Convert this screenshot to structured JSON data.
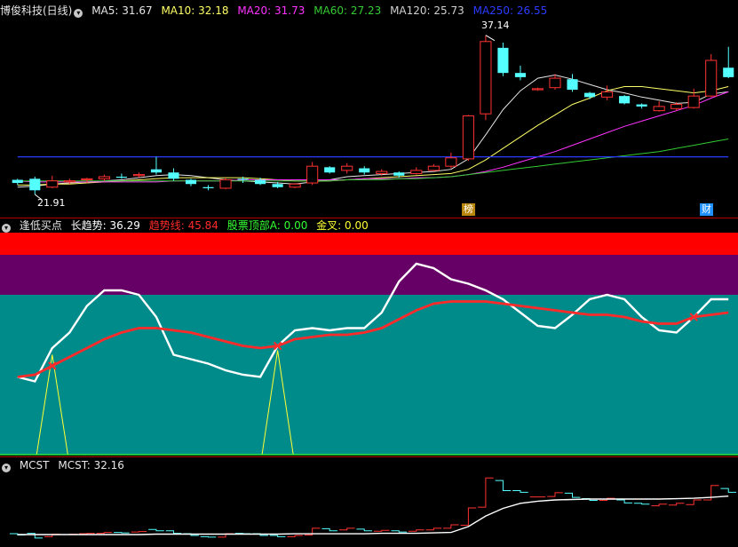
{
  "main": {
    "title": "博俊科技(日线)",
    "ma": [
      {
        "label": "MA5: 31.67",
        "color": "#e6e6e6"
      },
      {
        "label": "MA10: 32.18",
        "color": "#ffff66"
      },
      {
        "label": "MA20: 31.73",
        "color": "#ff33ff"
      },
      {
        "label": "MA60: 27.23",
        "color": "#33cc33"
      },
      {
        "label": "MA120: 25.73",
        "color": "#d0d0d0"
      },
      {
        "label": "MA250: 26.55",
        "color": "#2b3bff"
      }
    ],
    "high_label": "37.14",
    "low_label": "21.91",
    "markers": [
      "榜",
      "财"
    ]
  },
  "indicator": {
    "title": "逢低买点",
    "items": [
      {
        "label": "长趋势: 36.29",
        "color": "#ffffff"
      },
      {
        "label": "趋势线: 45.84",
        "color": "#ff2a2a"
      },
      {
        "label": "股票顶部A: 0.00",
        "color": "#33ff33"
      },
      {
        "label": "金叉: 0.00",
        "color": "#ffff33"
      }
    ]
  },
  "mcst": {
    "title": "MCST",
    "value_label": "MCST: 32.16"
  },
  "chart_data": [
    {
      "type": "candlestick",
      "title": "博俊科技(日线)",
      "candles": [
        [
          23.3,
          23.4,
          22.8,
          23.0
        ],
        [
          23.4,
          23.6,
          21.9,
          22.3
        ],
        [
          22.6,
          23.7,
          22.5,
          23.2
        ],
        [
          23.1,
          23.4,
          22.9,
          23.2
        ],
        [
          23.3,
          23.5,
          23.0,
          23.4
        ],
        [
          23.4,
          23.8,
          23.2,
          23.6
        ],
        [
          23.6,
          23.9,
          23.4,
          23.5
        ],
        [
          23.7,
          24.0,
          23.5,
          23.8
        ],
        [
          24.3,
          25.5,
          23.8,
          24.0
        ],
        [
          24.0,
          24.4,
          23.2,
          23.4
        ],
        [
          23.3,
          23.4,
          22.7,
          22.9
        ],
        [
          22.6,
          22.8,
          22.3,
          22.5
        ],
        [
          22.5,
          23.5,
          22.4,
          23.3
        ],
        [
          23.4,
          23.6,
          23.0,
          23.3
        ],
        [
          23.3,
          23.5,
          22.8,
          22.9
        ],
        [
          22.9,
          23.1,
          22.5,
          22.6
        ],
        [
          22.6,
          23.0,
          22.5,
          22.9
        ],
        [
          23.0,
          25.0,
          22.8,
          24.6
        ],
        [
          24.5,
          24.6,
          23.9,
          24.0
        ],
        [
          24.2,
          24.9,
          23.9,
          24.6
        ],
        [
          24.4,
          24.6,
          23.8,
          24.0
        ],
        [
          23.9,
          24.3,
          23.7,
          24.1
        ],
        [
          24.0,
          24.1,
          23.5,
          23.7
        ],
        [
          23.9,
          24.5,
          23.8,
          24.2
        ],
        [
          24.2,
          24.8,
          24.1,
          24.6
        ],
        [
          24.6,
          25.9,
          24.4,
          25.4
        ],
        [
          25.3,
          29.5,
          25.1,
          29.4
        ],
        [
          29.6,
          37.1,
          29.0,
          36.5
        ],
        [
          35.9,
          36.4,
          33.2,
          33.5
        ],
        [
          33.5,
          34.2,
          32.8,
          33.1
        ],
        [
          32.0,
          32.1,
          31.8,
          32.0
        ],
        [
          32.1,
          33.4,
          31.9,
          33.0
        ],
        [
          32.9,
          33.4,
          31.7,
          31.9
        ],
        [
          31.6,
          31.7,
          31.0,
          31.2
        ],
        [
          31.2,
          32.3,
          30.9,
          31.7
        ],
        [
          31.3,
          31.4,
          30.5,
          30.6
        ],
        [
          30.5,
          30.6,
          30.1,
          30.3
        ],
        [
          29.9,
          30.8,
          29.8,
          30.3
        ],
        [
          30.1,
          30.7,
          29.9,
          30.5
        ],
        [
          30.2,
          32.0,
          30.1,
          31.3
        ],
        [
          31.3,
          35.3,
          31.2,
          34.7
        ],
        [
          34.0,
          36.0,
          33.0,
          33.1
        ]
      ],
      "ma_series": {
        "MA5": [
          22.6,
          22.7,
          22.9,
          23.0,
          23.1,
          23.2,
          23.3,
          23.5,
          23.7,
          23.8,
          23.7,
          23.5,
          23.3,
          23.2,
          23.1,
          23.0,
          22.9,
          23.1,
          23.3,
          23.6,
          23.7,
          23.8,
          23.9,
          24.0,
          24.1,
          24.3,
          25.3,
          27.6,
          30.0,
          31.8,
          33.0,
          33.3,
          32.9,
          32.4,
          31.9,
          31.6,
          31.2,
          30.9,
          30.6,
          30.7,
          31.5,
          31.7
        ],
        "MA10": [
          22.8,
          22.8,
          22.9,
          22.9,
          23.0,
          23.1,
          23.2,
          23.3,
          23.4,
          23.5,
          23.5,
          23.5,
          23.5,
          23.5,
          23.4,
          23.3,
          23.2,
          23.2,
          23.2,
          23.3,
          23.4,
          23.5,
          23.6,
          23.7,
          23.8,
          23.9,
          24.3,
          25.2,
          26.3,
          27.4,
          28.5,
          29.5,
          30.5,
          31.1,
          31.8,
          32.2,
          32.2,
          32.0,
          31.8,
          31.6,
          31.8,
          32.2
        ],
        "MA20": [
          23.2,
          23.1,
          23.1,
          23.1,
          23.1,
          23.1,
          23.1,
          23.1,
          23.1,
          23.2,
          23.2,
          23.2,
          23.2,
          23.3,
          23.3,
          23.3,
          23.3,
          23.3,
          23.3,
          23.3,
          23.4,
          23.4,
          23.4,
          23.5,
          23.5,
          23.6,
          23.8,
          24.1,
          24.5,
          25.0,
          25.5,
          26.0,
          26.6,
          27.2,
          27.8,
          28.4,
          28.9,
          29.4,
          29.9,
          30.4,
          31.1,
          31.7
        ],
        "MA60": [
          23.2,
          23.2,
          23.2,
          23.2,
          23.2,
          23.2,
          23.2,
          23.2,
          23.2,
          23.2,
          23.2,
          23.2,
          23.2,
          23.2,
          23.2,
          23.2,
          23.2,
          23.2,
          23.2,
          23.3,
          23.3,
          23.3,
          23.4,
          23.4,
          23.5,
          23.6,
          23.8,
          24.0,
          24.2,
          24.4,
          24.6,
          24.8,
          25.0,
          25.2,
          25.4,
          25.6,
          25.8,
          26.0,
          26.3,
          26.6,
          26.9,
          27.2
        ],
        "MA250": [
          25.5,
          25.5,
          25.5,
          25.5,
          25.5,
          25.5,
          25.5,
          25.5,
          25.5,
          25.5,
          25.5,
          25.5,
          25.5,
          25.5,
          25.5,
          25.5,
          25.5,
          25.5,
          25.5,
          25.5,
          25.5,
          25.5,
          25.5,
          25.5,
          25.5,
          25.5,
          25.5,
          25.5,
          25.5,
          25.5,
          25.5,
          25.5,
          25.5,
          25.5,
          25.5,
          25.5,
          25.5,
          25.5,
          25.5,
          25.5,
          25.5,
          25.5
        ]
      },
      "marker_positions": [
        25,
        38
      ]
    },
    {
      "type": "line",
      "title": "逢低买点",
      "ylim": [
        0,
        100
      ],
      "bands": [
        {
          "from": 90,
          "to": 100,
          "color": "#ff0000"
        },
        {
          "from": 72,
          "to": 90,
          "color": "#660066"
        },
        {
          "from": 0,
          "to": 72,
          "color": "#008b8b"
        }
      ],
      "series": [
        {
          "name": "长趋势",
          "color": "#ffffff",
          "values": [
            35,
            33,
            48,
            55,
            67,
            74,
            74,
            72,
            62,
            45,
            43,
            41,
            38,
            36,
            35,
            49,
            56,
            57,
            56,
            57,
            57,
            64,
            78,
            86,
            84,
            79,
            77,
            74,
            70,
            64,
            58,
            57,
            63,
            70,
            72,
            70,
            62,
            56,
            55,
            62,
            70,
            70
          ]
        },
        {
          "name": "趋势线",
          "color": "#ff2a2a",
          "values": [
            35,
            36,
            40,
            44,
            48,
            52,
            55,
            57,
            57,
            56,
            55,
            53,
            51,
            49,
            48,
            49,
            52,
            53,
            54,
            54,
            55,
            57,
            61,
            65,
            68,
            69,
            69,
            69,
            68,
            67,
            66,
            65,
            64,
            63,
            63,
            62,
            60,
            59,
            59,
            62,
            63,
            64
          ]
        },
        {
          "name": "股票顶部A",
          "color": "#33ff33",
          "values": [
            0,
            0,
            0,
            0,
            0,
            0,
            0,
            0,
            0,
            0,
            0,
            0,
            0,
            0,
            0,
            0,
            0,
            0,
            0,
            0,
            0,
            0,
            0,
            0,
            0,
            0,
            0,
            0,
            0,
            0,
            0,
            0,
            0,
            0,
            0,
            0,
            0,
            0,
            0,
            0,
            0,
            0
          ]
        },
        {
          "name": "金叉",
          "color": "#ffff33",
          "values": [
            0,
            0,
            45,
            0,
            0,
            0,
            0,
            0,
            0,
            0,
            0,
            0,
            0,
            0,
            0,
            47,
            0,
            0,
            0,
            0,
            0,
            0,
            0,
            0,
            0,
            0,
            0,
            0,
            0,
            0,
            0,
            0,
            0,
            0,
            0,
            0,
            0,
            0,
            0,
            0,
            0,
            0
          ]
        }
      ],
      "cross_marks": [
        2,
        15,
        39
      ]
    },
    {
      "type": "line",
      "title": "MCST",
      "series": [
        {
          "name": "MCST",
          "color": "#ffffff",
          "values": [
            23.1,
            23.1,
            23.1,
            23.1,
            23.1,
            23.1,
            23.1,
            23.1,
            23.2,
            23.2,
            23.2,
            23.2,
            23.2,
            23.2,
            23.2,
            23.2,
            23.3,
            23.3,
            23.3,
            23.3,
            23.3,
            23.4,
            23.4,
            23.4,
            23.5,
            23.6,
            25.0,
            27.5,
            29.3,
            30.5,
            31.0,
            31.3,
            31.4,
            31.5,
            31.5,
            31.5,
            31.5,
            31.5,
            31.6,
            31.7,
            31.9,
            32.2
          ]
        }
      ]
    }
  ]
}
